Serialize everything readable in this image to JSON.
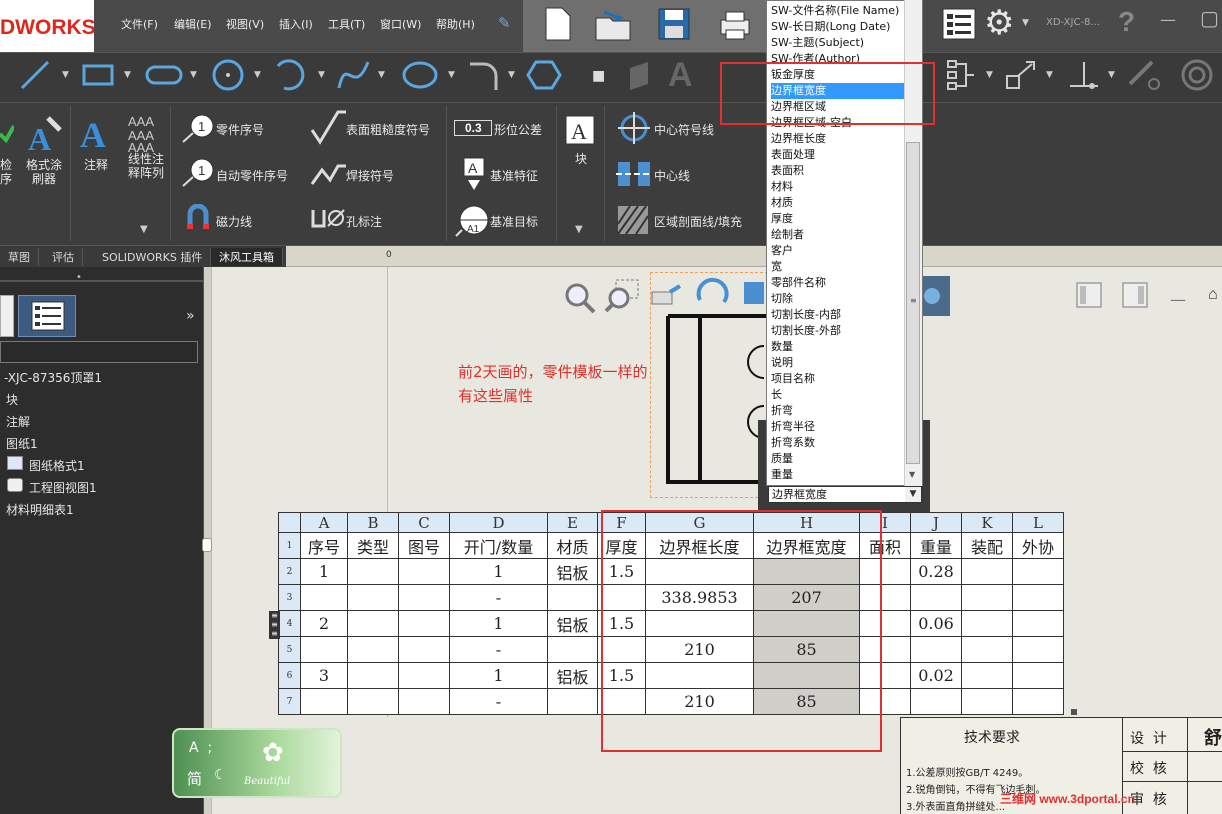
{
  "app": {
    "logo": "DWORKS",
    "title": "XD-XJC-8...",
    "help": "?"
  },
  "menu": [
    "文件(F)",
    "编辑(E)",
    "视图(V)",
    "插入(I)",
    "工具(T)",
    "窗口(W)",
    "帮助(H)"
  ],
  "ribbon": {
    "col1": [
      "检",
      "序"
    ],
    "format_painter": [
      "格式涂",
      "刷器"
    ],
    "note": "注释",
    "linear_pattern": [
      "线性注",
      "释阵列"
    ],
    "balloon": "零件序号",
    "auto_balloon": "自动零件序号",
    "magnetic_line": "磁力线",
    "surface_finish": "表面粗糙度符号",
    "weld_symbol": "焊接符号",
    "hole_callout": "孔标注",
    "gtol": "形位公差",
    "datum_feature": "基准特征",
    "datum_target": "基准目标",
    "block": "块",
    "center_mark": "中心符号线",
    "centerline": "中心线",
    "hatch": "区域剖面线/填充",
    "gtol_icon": "0.3"
  },
  "tabs": [
    "草图",
    "评估",
    "SOLIDWORKS 插件",
    "沐风工具箱"
  ],
  "ruler": {
    "zero": "0"
  },
  "tree": [
    "-XJC-87356顶罩1",
    "块",
    "注解",
    "图纸1",
    "图纸格式1",
    "工程图视图1",
    "材料明细表1"
  ],
  "note": "前2天画的，零件模板一样的\n有这些属性",
  "dropdown": {
    "options": [
      "SW-文件名称(File Name)",
      "SW-长日期(Long Date)",
      "SW-主题(Subject)",
      "SW-作者(Author)",
      "钣金厚度",
      "边界框宽度",
      "边界框区域",
      "边界框区域-空白",
      "边界框长度",
      "表面处理",
      "表面积",
      "材料",
      "材质",
      "厚度",
      "绘制者",
      "客户",
      "宽",
      "零部件名称",
      "切除",
      "切割长度-内部",
      "切割长度-外部",
      "数量",
      "说明",
      "项目名称",
      "长",
      "折弯",
      "折弯半径",
      "折弯系数",
      "质量",
      "重量"
    ],
    "selected_index": 5,
    "combo_value": "边界框宽度"
  },
  "table": {
    "columns": [
      "A",
      "B",
      "C",
      "D",
      "E",
      "F",
      "G",
      "H",
      "I",
      "J",
      "K",
      "L"
    ],
    "rows": [
      {
        "n": "1",
        "cells": [
          "序号",
          "类型",
          "图号",
          "开门/数量",
          "材质",
          "厚度",
          "边界框长度",
          "边界框宽度",
          "面积",
          "重量",
          "装配",
          "外协"
        ]
      },
      {
        "n": "2",
        "cells": [
          "1",
          "",
          "",
          "1",
          "铝板",
          "1.5",
          "",
          "",
          "",
          "0.28",
          "",
          ""
        ]
      },
      {
        "n": "3",
        "cells": [
          "",
          "",
          "",
          "-",
          "",
          "",
          "338.9853",
          "207",
          "",
          "",
          "",
          ""
        ]
      },
      {
        "n": "4",
        "cells": [
          "2",
          "",
          "",
          "1",
          "铝板",
          "1.5",
          "",
          "",
          "",
          "0.06",
          "",
          ""
        ]
      },
      {
        "n": "5",
        "cells": [
          "",
          "",
          "",
          "-",
          "",
          "",
          "210",
          "85",
          "",
          "",
          "",
          ""
        ]
      },
      {
        "n": "6",
        "cells": [
          "3",
          "",
          "",
          "1",
          "铝板",
          "1.5",
          "",
          "",
          "",
          "0.02",
          "",
          ""
        ]
      },
      {
        "n": "7",
        "cells": [
          "",
          "",
          "",
          "-",
          "",
          "",
          "210",
          "85",
          "",
          "",
          "",
          ""
        ]
      }
    ]
  },
  "tech": {
    "title": "技术要求",
    "lines": [
      "1.公差原则按GB/T 4249。",
      "2.锐角倒钝，不得有飞边毛刺。",
      "3.外表面直角拼缝处..."
    ],
    "side": [
      "设  计",
      "校  核",
      "审  核"
    ],
    "corner": "舒"
  },
  "ime": {
    "row1": "A  ;",
    "row2": "简",
    "brand": "Beautiful"
  },
  "watermark": "三维网 www.3dportal.cn",
  "colors": {
    "highlight_box": "#e03030",
    "selection": "#3399ff",
    "header_cell": "#dbe8f5"
  }
}
